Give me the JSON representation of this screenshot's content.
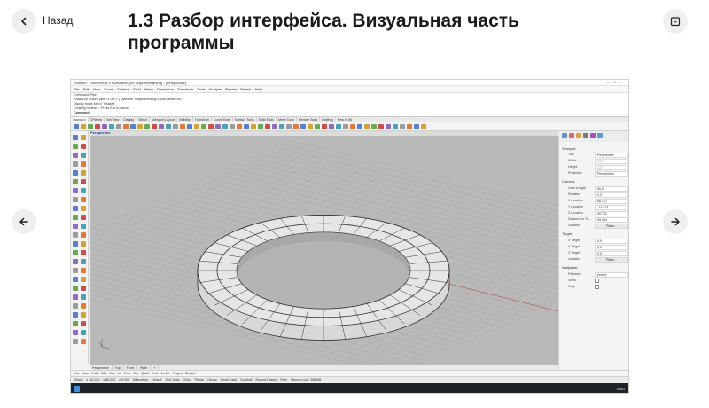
{
  "nav": {
    "back_label": "Назад"
  },
  "lesson": {
    "title": "1.3 Разбор интерфейса. Визуальная часть программы"
  },
  "screenshot": {
    "window_title": "Untitled - Rhinoceros 6 Evaluation (45 Days Remaining) - [Perspective]",
    "menu": [
      "File",
      "Edit",
      "View",
      "Curve",
      "Surface",
      "Solid",
      "Mesh",
      "Dimension",
      "Transform",
      "Tools",
      "Analyze",
      "Render",
      "Panels",
      "Help"
    ],
    "command_history": [
      "Command: Pipe",
      "Radius for closed pipe <1.007> ( Diameter ShapeBlending=Local FitRail=No ):",
      "Display mode set to \"Shaded\".",
      "Creating meshes... Press Esc to cancel"
    ],
    "command_prompt": "Command:",
    "toolbar_tabs": [
      "Standard",
      "CPlanes",
      "Set View",
      "Display",
      "Select",
      "Viewport Layout",
      "Visibility",
      "Transform",
      "Curve Tools",
      "Surface Tools",
      "Solid Tools",
      "Mesh Tools",
      "Render Tools",
      "Drafting",
      "New in V6"
    ],
    "viewport_label": "Perspective",
    "viewport_tabs": [
      "Perspective",
      "Top",
      "Front",
      "Right",
      "+"
    ],
    "osnaps": [
      "End",
      "Near",
      "Point",
      "Mid",
      "Cen",
      "Int",
      "Perp",
      "Tan",
      "Quad",
      "Knot",
      "Vertex",
      "Project",
      "Disable"
    ],
    "status": [
      "World",
      "x -50.220",
      "y 85.000",
      "z 0.000",
      "Millimeters",
      "Default",
      "Grid Snap",
      "Ortho",
      "Planar",
      "Osnap",
      "SmartTrack",
      "Gumball",
      "Record History",
      "Filter",
      "Memory use: 388 MB"
    ],
    "properties": {
      "viewport_section": "Viewport",
      "viewport_rows": [
        {
          "key": "Title",
          "value": "Perspective"
        },
        {
          "key": "Width",
          "value": "1077"
        },
        {
          "key": "Height",
          "value": "727"
        },
        {
          "key": "Projection",
          "value": "Perspective"
        }
      ],
      "camera_section": "Camera",
      "camera_rows": [
        {
          "key": "Lens Length",
          "value": "50.0"
        },
        {
          "key": "Rotation",
          "value": "0.0"
        },
        {
          "key": "X Location",
          "value": "60.717"
        },
        {
          "key": "Y Location",
          "value": "-74.673"
        },
        {
          "key": "Z Location",
          "value": "40.702"
        },
        {
          "key": "Distance to Ta...",
          "value": "99.284"
        },
        {
          "key": "Location",
          "value": "Place..."
        }
      ],
      "target_section": "Target",
      "target_rows": [
        {
          "key": "X Target",
          "value": "0.0"
        },
        {
          "key": "Y Target",
          "value": "0.0"
        },
        {
          "key": "Z Target",
          "value": "0.0"
        },
        {
          "key": "Location",
          "value": "Place..."
        }
      ],
      "wallpaper_section": "Wallpaper",
      "wallpaper_rows": [
        {
          "key": "Filename",
          "value": "(none)"
        },
        {
          "key": "Show",
          "value": ""
        },
        {
          "key": "Gray",
          "value": ""
        }
      ]
    },
    "taskbar_time": "ENG"
  },
  "colors": {
    "button_bg": "#efefef",
    "title": "#1a1a1a",
    "viewport_bg": "#b9b9b9"
  },
  "icons": {
    "back": "chevron-left-icon",
    "bookmark": "bookmark-icon",
    "prev": "arrow-left-icon",
    "next": "arrow-right-icon"
  }
}
